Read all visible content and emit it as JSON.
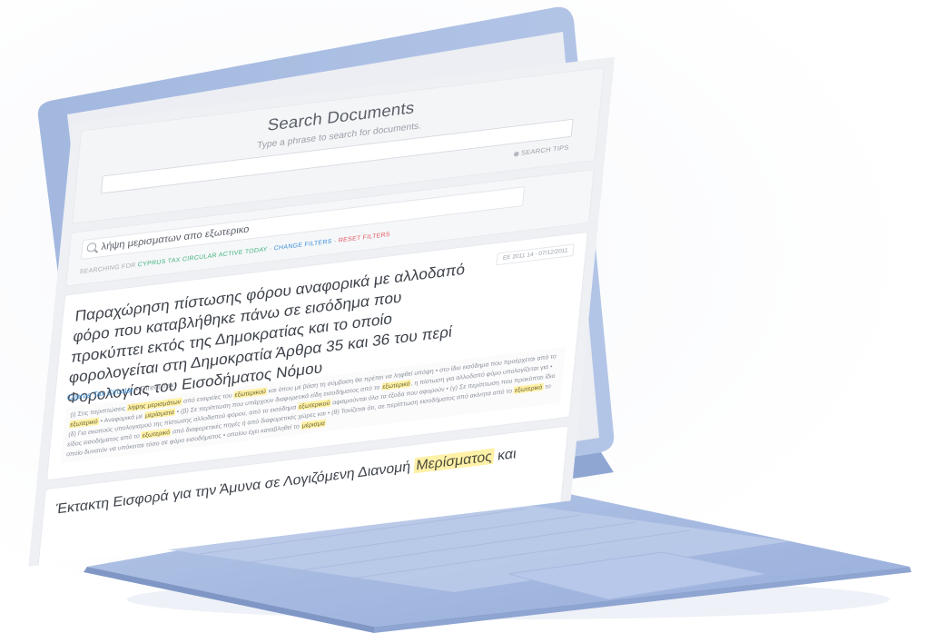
{
  "search": {
    "title": "Search Documents",
    "subtitle": "Type a phrase to search for documents.",
    "tips_label": "SEARCH TIPS"
  },
  "query": {
    "value": "λήψη μερισματων απο εξωτερικο",
    "filters": {
      "prefix": "SEARCHING FOR",
      "type": "CYPRUS TAX CIRCULAR",
      "status": "ACTIVE TODAY",
      "change": "CHANGE FILTERS",
      "reset": "RESET FILTERS"
    }
  },
  "results": [
    {
      "title": "Παραχώρηση πίστωσης φόρου αναφορικά με αλλοδαπό φόρο που καταβλήθηκε πάνω σε εισόδημα που προκύπτει εκτός της Δημοκρατίας και το οποίο φορολογείται στη Δημοκρατία Άρθρα 35 και 36 του περί Φορολογίας του Εισοδήματος Νόμου",
      "date_badge": "ΕΕ 2011 14 - 07/12/2011",
      "source": "Cyprus Tax Circular",
      "category": "Direct Tax",
      "excerpt": [
        {
          "t": "(i) Στις περιπτώσεις "
        },
        {
          "t": "λήψης μερισμάτων",
          "h": true
        },
        {
          "t": " από εταιρείες του "
        },
        {
          "t": "εξωτερικού",
          "h": true
        },
        {
          "t": " και όπου με βάση τη σύμβαση θα πρέπει να ληφθεί υπόψη • στο ίδιο εισόδημα που προέρχεται από το "
        },
        {
          "t": "εξωτερικό",
          "h": true
        },
        {
          "t": " • Αναφορικά με "
        },
        {
          "t": "μερίσματα",
          "h": true
        },
        {
          "t": " • (β) Σε περίπτωση που υπάρχουν διαφορετικά είδη εισοδήματος από το "
        },
        {
          "t": "εξωτερικό",
          "h": true
        },
        {
          "t": ", η πίστωση για αλλοδαπό φόρο υπολογίζεται για • (δ) Για σκοπούς υπολογισμού της πίστωσης αλλοδαπού φόρου, από το εισόδημα "
        },
        {
          "t": "εξωτερικού",
          "h": true
        },
        {
          "t": " αφαιρούνται όλα τα έξοδα που αφορούν • (γ) Σε περίπτωση που προκύπτει ίδιο είδος εισοδήματος από το "
        },
        {
          "t": "εξωτερικό",
          "h": true
        },
        {
          "t": " από διαφορετικές πηγές ή από διαφορετικές χώρες και • (θ) Τονίζεται ότι, σε περίπτωση εισοδήματος από ακίνητα από το "
        },
        {
          "t": "εξωτερικό",
          "h": true
        },
        {
          "t": " το οποίο δυνατόν να υπόκειται τόσο σε φόρο εισοδήματος • οποίου έχει καταβληθεί το "
        },
        {
          "t": "μέρισμα",
          "h": true
        }
      ]
    },
    {
      "title_before": "Έκτακτη Εισφορά για την Άμυνα σε Λογιζόμενη Διανομή ",
      "title_highlight": "Μερίσματος",
      "title_after": " και"
    }
  ],
  "colors": {
    "laptop_body": "#a9bde0",
    "laptop_shadow": "#8fa6cf",
    "highlight": "#fff1a8",
    "link_blue": "#3b8fd9",
    "filter_green": "#3fb27f",
    "filter_red": "#e0585f"
  }
}
